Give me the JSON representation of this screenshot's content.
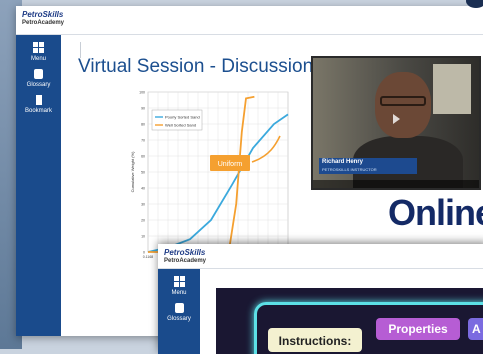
{
  "brand": {
    "line1": "PetroSkills",
    "line2": "PetroAcademy"
  },
  "sidebar": {
    "items": [
      {
        "label": "Menu",
        "icon": "menu-grid-icon"
      },
      {
        "label": "Glossary",
        "icon": "glossary-cube-icon"
      },
      {
        "label": "Bookmark",
        "icon": "bookmark-icon"
      }
    ]
  },
  "slide": {
    "title": "Virtual Session - Discussion",
    "banner": "Online"
  },
  "video": {
    "name": "Richard Henry",
    "role": "PETROSKILLS INSTRUCTOR"
  },
  "window2": {
    "sidebar": [
      {
        "label": "Menu",
        "icon": "menu-grid-icon"
      },
      {
        "label": "Glossary",
        "icon": "glossary-cube-icon"
      }
    ],
    "game": {
      "instructions": "Instructions:",
      "btn_properties": "Properties",
      "btn_a": "A"
    }
  },
  "chart_data": {
    "type": "line",
    "title": "",
    "xlabel": "",
    "ylabel": "Cumulative Weight (%)",
    "ylim": [
      0,
      100
    ],
    "yticks": [
      "0",
      "10",
      "20",
      "30",
      "40",
      "50",
      "60",
      "70",
      "80",
      "90",
      "100"
    ],
    "xticks": [
      "0.1168"
    ],
    "annotation": "Uniform",
    "series": [
      {
        "name": "Poorly Sorted Sand",
        "color": "#3ba9dd",
        "x": [
          0,
          0.15,
          0.3,
          0.45,
          0.6,
          0.75,
          0.9,
          1.0
        ],
        "values": [
          0,
          3,
          8,
          20,
          42,
          65,
          80,
          86
        ]
      },
      {
        "name": "Well Sorted Sand",
        "color": "#f5a030",
        "x": [
          0,
          0.45,
          0.58,
          0.63,
          0.67,
          0.7,
          0.76
        ],
        "values": [
          0,
          0,
          2,
          30,
          75,
          96,
          97
        ]
      }
    ]
  }
}
